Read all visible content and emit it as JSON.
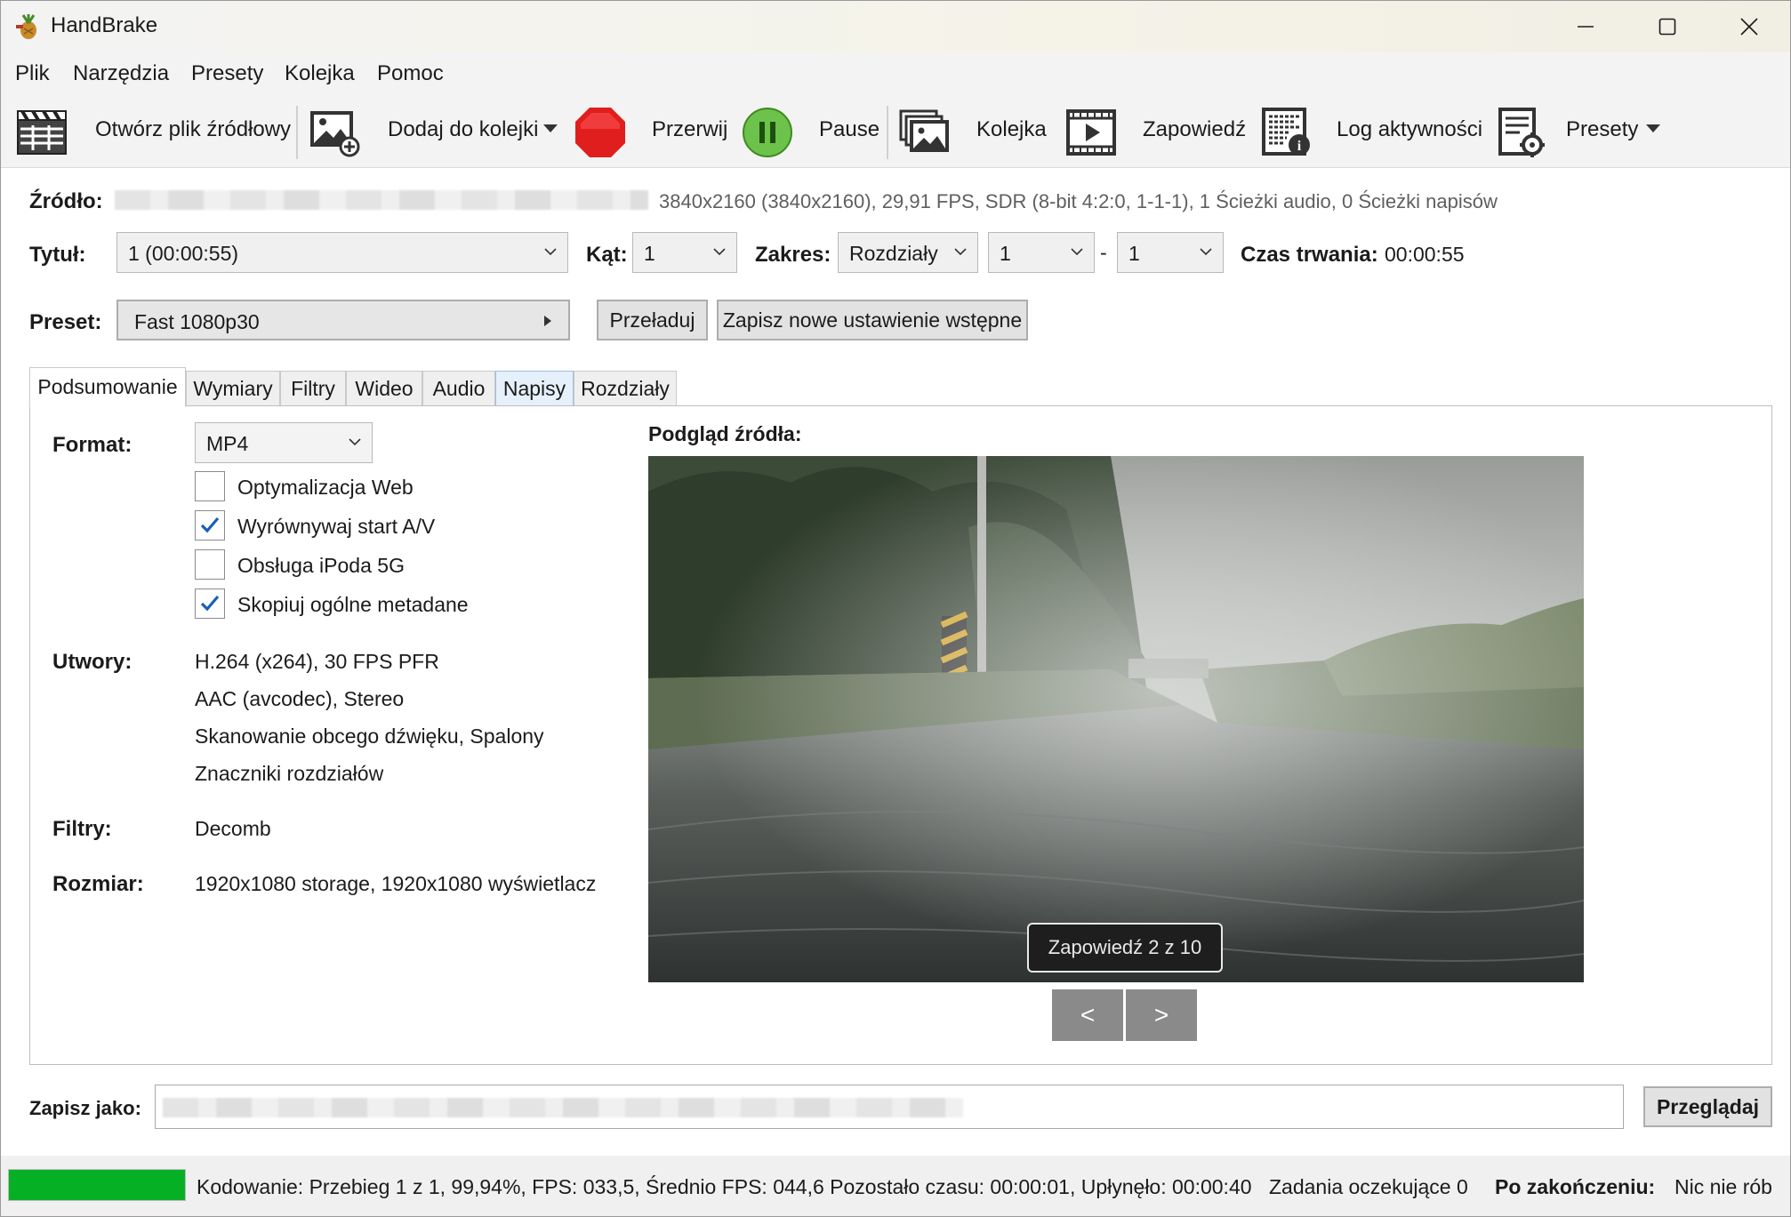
{
  "window": {
    "title": "HandBrake"
  },
  "menu": [
    "Plik",
    "Narzędzia",
    "Presety",
    "Kolejka",
    "Pomoc"
  ],
  "toolbar": {
    "open_source": "Otwórz plik źródłowy",
    "add_queue": "Dodaj do kolejki",
    "stop": "Przerwij",
    "pause": "Pause",
    "queue": "Kolejka",
    "preview": "Zapowiedź",
    "activity_log": "Log aktywności",
    "presets": "Presety"
  },
  "source": {
    "label": "Źródło:",
    "info": "3840x2160 (3840x2160), 29,91 FPS, SDR (8-bit 4:2:0, 1-1-1), 1 Ścieżki audio, 0 Ścieżki napisów"
  },
  "title_row": {
    "title_label": "Tytuł:",
    "title_value": "1  (00:00:55)",
    "angle_label": "Kąt:",
    "angle_value": "1",
    "range_label": "Zakres:",
    "range_type": "Rozdziały",
    "range_start": "1",
    "range_dash": "-",
    "range_end": "1",
    "duration_label": "Czas trwania:",
    "duration_value": "00:00:55"
  },
  "preset_row": {
    "label": "Preset:",
    "value": "Fast 1080p30",
    "reload": "Przeładuj",
    "save_new": "Zapisz nowe ustawienie wstępne"
  },
  "tabs": [
    "Podsumowanie",
    "Wymiary",
    "Filtry",
    "Wideo",
    "Audio",
    "Napisy",
    "Rozdziały"
  ],
  "summary": {
    "format_label": "Format:",
    "format_value": "MP4",
    "options": [
      {
        "label": "Optymalizacja Web",
        "checked": false
      },
      {
        "label": "Wyrównywaj start A/V",
        "checked": true
      },
      {
        "label": "Obsługa iPoda 5G",
        "checked": false
      },
      {
        "label": "Skopiuj ogólne metadane",
        "checked": true
      }
    ],
    "tracks_label": "Utwory:",
    "tracks": [
      "H.264 (x264), 30 FPS PFR",
      "AAC (avcodec), Stereo",
      "Skanowanie obcego dźwięku, Spalony",
      "Znaczniki rozdziałów"
    ],
    "filters_label": "Filtry:",
    "filters_value": "Decomb",
    "size_label": "Rozmiar:",
    "size_value": "1920x1080 storage, 1920x1080 wyświetlacz",
    "preview_label": "Podgląd źródła:",
    "preview_caption": "Zapowiedź 2 z 10",
    "prev": "<",
    "next": ">"
  },
  "save": {
    "label": "Zapisz jako:",
    "browse": "Przeglądaj"
  },
  "status": {
    "progress": 0.9994,
    "progress_color": "#06b025",
    "encoding": "Kodowanie: Przebieg 1 z 1, 99,94%, FPS: 033,5, Średnio FPS: 044,6 Pozostało czasu: 00:00:01, Upłynęło: 00:00:40",
    "pending": "Zadania oczekujące 0",
    "after_label": "Po zakończeniu:",
    "after_value": "Nic nie rób"
  }
}
